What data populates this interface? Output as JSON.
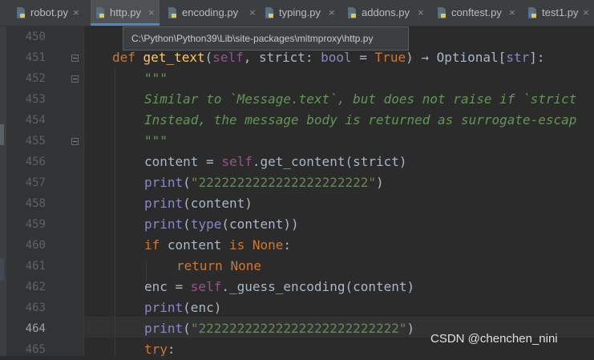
{
  "tabs": [
    {
      "name": "robot.py",
      "close": "×",
      "active": false
    },
    {
      "name": "http.py",
      "close": "×",
      "active": true
    },
    {
      "name": "encoding.py",
      "close": "×",
      "active": false
    },
    {
      "name": "typing.py",
      "close": "×",
      "active": false
    },
    {
      "name": "addons.py",
      "close": "×",
      "active": false
    },
    {
      "name": "conftest.py",
      "close": "×",
      "active": false
    },
    {
      "name": "test1.py",
      "close": "×",
      "active": false
    }
  ],
  "tooltip": {
    "path": "C:\\Python\\Python39\\Lib\\site-packages\\mitmproxy\\http.py"
  },
  "editor": {
    "current_line": "464",
    "line_numbers": [
      "450",
      "451",
      "452",
      "453",
      "454",
      "455",
      "456",
      "457",
      "458",
      "459",
      "460",
      "461",
      "462",
      "463",
      "464",
      "465"
    ],
    "code": {
      "l451": {
        "kw_def": "def",
        "fn_name": "get_text",
        "p_open": "(",
        "self": "self",
        "args": ", strict: ",
        "type_bool": "bool",
        "eq": " = ",
        "kw_true": "True",
        "tail": ") → Optional[",
        "type_str": "str",
        "end": "]:"
      },
      "l452": "\"\"\"",
      "l453": "Similar to `Message.text`, but does not raise if `strict",
      "l454": "Instead, the message body is returned as surrogate-escap",
      "l455": "\"\"\"",
      "l456": {
        "pre": "content = ",
        "self": "self",
        "post": ".get_content(strict)"
      },
      "l457": {
        "fn": "print",
        "open": "(",
        "str": "\"2222222222222222222222\"",
        "close": ")"
      },
      "l458": {
        "fn": "print",
        "rest": "(content)"
      },
      "l459": {
        "fn": "print",
        "open": "(",
        "fn2": "type",
        "rest": "(content))"
      },
      "l460": {
        "kw_if": "if",
        "mid": " content ",
        "kw_is": "is",
        "sp": " ",
        "kw_none": "None",
        "colon": ":"
      },
      "l461": {
        "kw_return": "return",
        "sp": " ",
        "kw_none": "None"
      },
      "l462": {
        "pre": "enc = ",
        "self": "self",
        "post": "._guess_encoding(content)"
      },
      "l463": {
        "fn": "print",
        "rest": "(enc)"
      },
      "l464": {
        "fn": "print",
        "open": "(",
        "str": "\"22222222222222222222222222\"",
        "close": ")"
      },
      "l465": {
        "kw_try": "try",
        "colon": ":"
      }
    }
  },
  "watermark": "CSDN @chenchen_nini",
  "colors": {
    "background": "#2b2b2b",
    "keyword": "#cc7832",
    "function": "#ffc66d",
    "self": "#94558d",
    "builtin": "#8888c6",
    "string": "#6a8759",
    "docstring": "#629755",
    "accent": "#4a88c7"
  },
  "icons": {
    "file": "python-file-icon",
    "close": "close-icon",
    "fold": "fold-marker-icon"
  }
}
